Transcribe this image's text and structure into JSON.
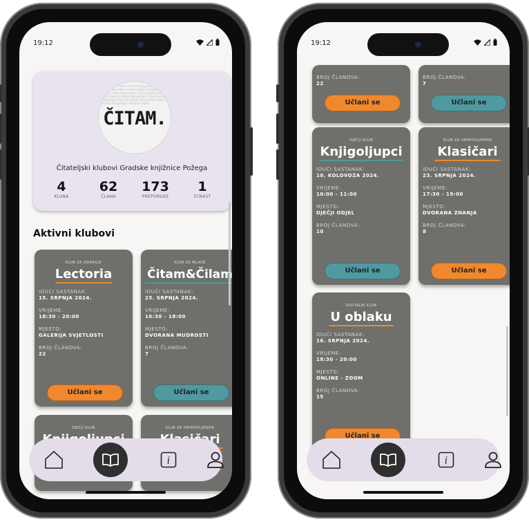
{
  "status": {
    "time": "19:12"
  },
  "hero": {
    "brand": "ČITAM.",
    "pattern_text": "Neprestano Citam Lectoria Knjigoljupci Klasicari Oblak Neprestano Citam Lectoria Knjigoljupci Klasicari Oblak Neprestano Citam Lectoria Knjigoljupci Klasicari Oblak Neprestano Citam Lectoria Knjigoljupci Klasicari Oblak Neprestano Citam Lectoria Knjigoljupci Klasicari Oblak",
    "subtitle": "Čitateljski klubovi Gradske knjižnice Požega",
    "stats": [
      {
        "value": "4",
        "label": "KLUBA"
      },
      {
        "value": "62",
        "label": "ČLANA"
      },
      {
        "value": "173",
        "label": "PREPORUKE"
      },
      {
        "value": "1",
        "label": "STRAST"
      }
    ]
  },
  "section_title": "Aktivni klubovi",
  "labels": {
    "next_meeting": "IDUĆI SASTANAK:",
    "time": "VRIJEME:",
    "place": "MJESTO:",
    "members": "BROJ ČLANOVA:",
    "join": "Učlani se"
  },
  "clubs": {
    "lectoria": {
      "type": "KLUB ZA ODRASLE",
      "name": "Lectoria",
      "date": "15. SRPNJA 2024.",
      "time": "18:30 - 20:00",
      "place": "GALERIJA SVJETLOSTI",
      "members": "22"
    },
    "citam": {
      "type": "KLUB ZA MLADE",
      "name": "Čitam&Čilam",
      "date": "25. SRPNJA 2024.",
      "time": "16:30 - 18:00",
      "place": "DVORANA MUDROSTI",
      "members": "7"
    },
    "knjigoljupci": {
      "type": "DJEČJI KLUB",
      "name": "Knjigoljupci",
      "date": "10. KOLOVOZA 2024.",
      "time": "10:00 - 11:00",
      "place": "DJEČJI ODJEL",
      "members": "10"
    },
    "klasicari": {
      "type": "KLUB ZA UMIROVLJENIKA",
      "name": "Klasičari",
      "date": "23. SRPNJA 2024.",
      "time": "17:30 - 19:00",
      "place": "DVORANA ZNANJA",
      "members": "8"
    },
    "oblak": {
      "type": "DIGITALNI KLUB",
      "name": "U oblaku",
      "date": "16. SRPNJA 2024.",
      "time": "18:30 - 20:00",
      "place": "ONLINE - ZOOM",
      "members": "15"
    }
  },
  "nav": [
    {
      "icon": "home-icon"
    },
    {
      "icon": "book-icon",
      "active": true
    },
    {
      "icon": "info-icon",
      "glyph": "i"
    },
    {
      "icon": "user-icon"
    }
  ],
  "colors": {
    "card": "#6f6f6b",
    "orange": "#f0892e",
    "teal": "#4f9aa0",
    "hero_bg": "#e8e3ee",
    "nav_bg": "#e4dde9"
  }
}
